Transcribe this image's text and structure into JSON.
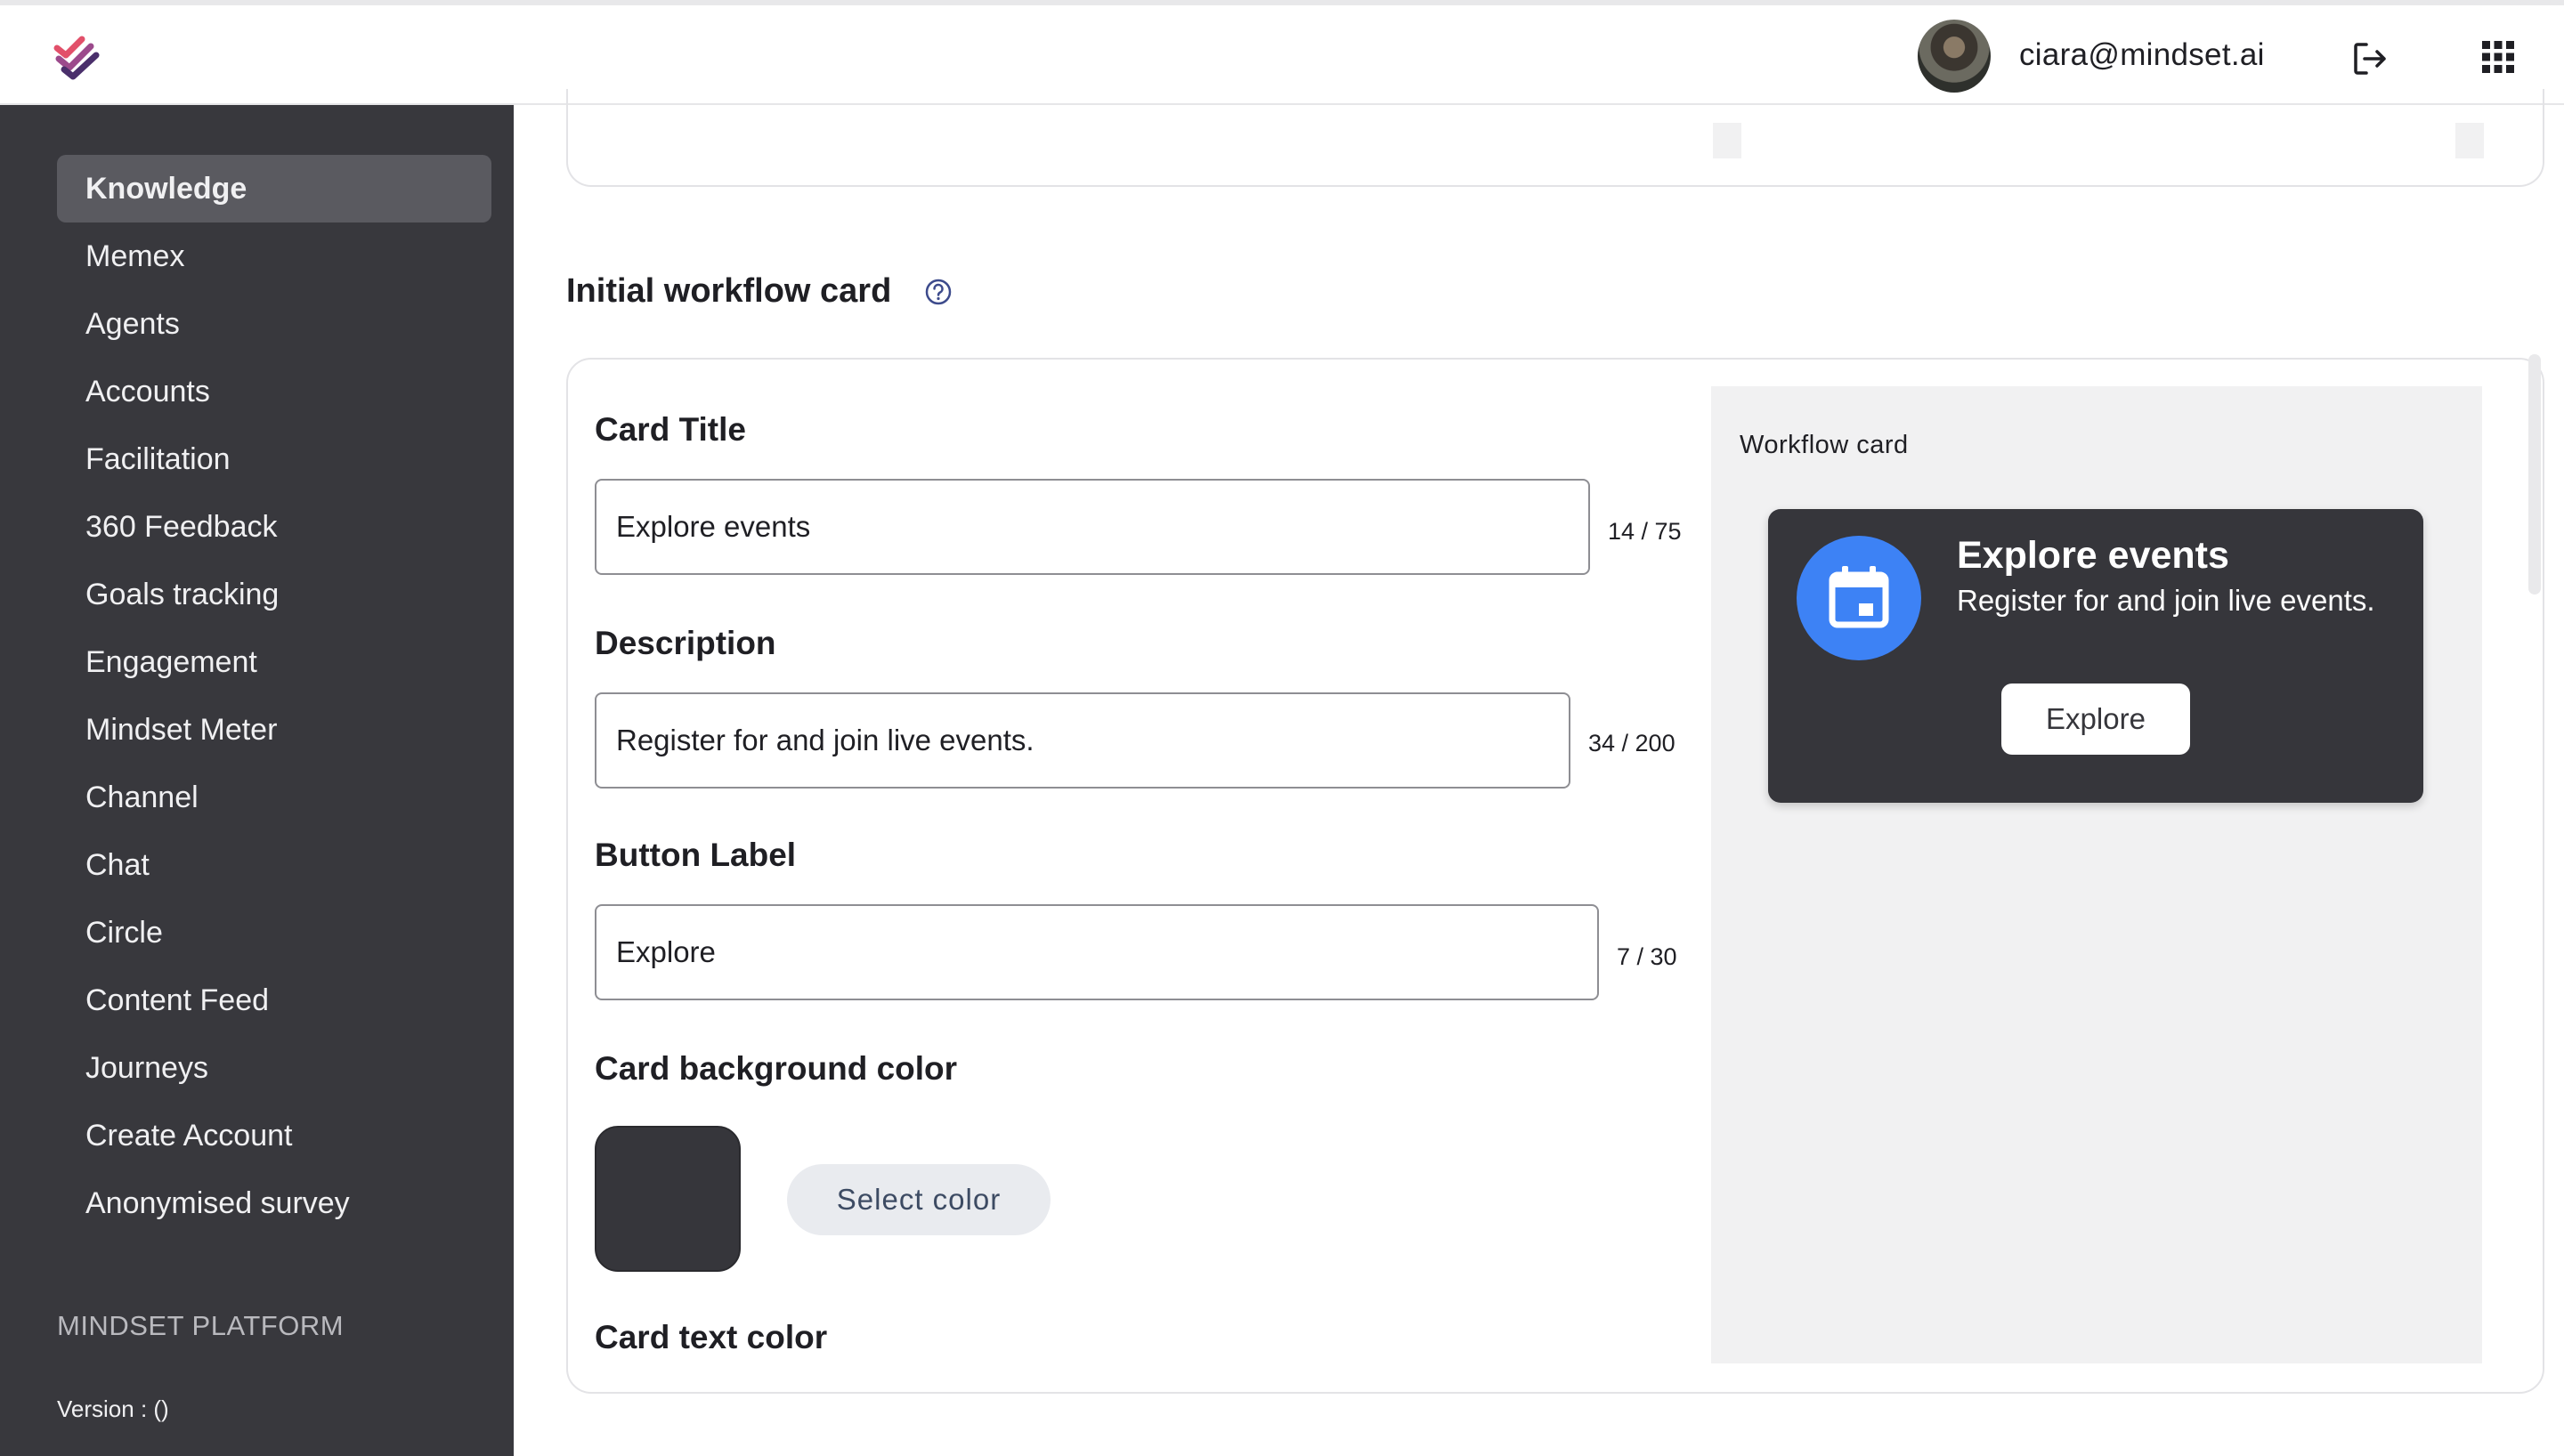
{
  "header": {
    "user_email": "ciara@mindset.ai"
  },
  "sidebar": {
    "items": [
      {
        "label": "Knowledge",
        "active": true
      },
      {
        "label": "Memex"
      },
      {
        "label": "Agents"
      },
      {
        "label": "Accounts"
      },
      {
        "label": "Facilitation"
      },
      {
        "label": "360 Feedback"
      },
      {
        "label": "Goals tracking"
      },
      {
        "label": "Engagement"
      },
      {
        "label": "Mindset Meter"
      },
      {
        "label": "Channel"
      },
      {
        "label": "Chat"
      },
      {
        "label": "Circle"
      },
      {
        "label": "Content Feed"
      },
      {
        "label": "Journeys"
      },
      {
        "label": "Create Account"
      },
      {
        "label": "Anonymised survey"
      }
    ],
    "platform_title": "MINDSET PLATFORM",
    "version": "Version :  ()"
  },
  "section": {
    "title": "Initial workflow card"
  },
  "form": {
    "card_title_label": "Card Title",
    "card_title_value": "Explore events",
    "card_title_counter": "14 / 75",
    "description_label": "Description",
    "description_value": "Register for and join live events.",
    "description_counter": "34 / 200",
    "button_label_label": "Button Label",
    "button_label_value": "Explore",
    "button_label_counter": "7 / 30",
    "bg_color_label": "Card background color",
    "bg_color_value": "#36363b",
    "select_color_label": "Select color",
    "text_color_label": "Card text color"
  },
  "preview": {
    "title": "Workflow card",
    "card_title": "Explore events",
    "card_description": "Register for and join live events.",
    "card_button": "Explore",
    "icon": "calendar-icon",
    "icon_bg_color": "#3d82f5"
  },
  "colors": {
    "sidebar_bg": "#38383d",
    "accent_blue": "#3d82f5",
    "card_bg": "#36363b"
  }
}
